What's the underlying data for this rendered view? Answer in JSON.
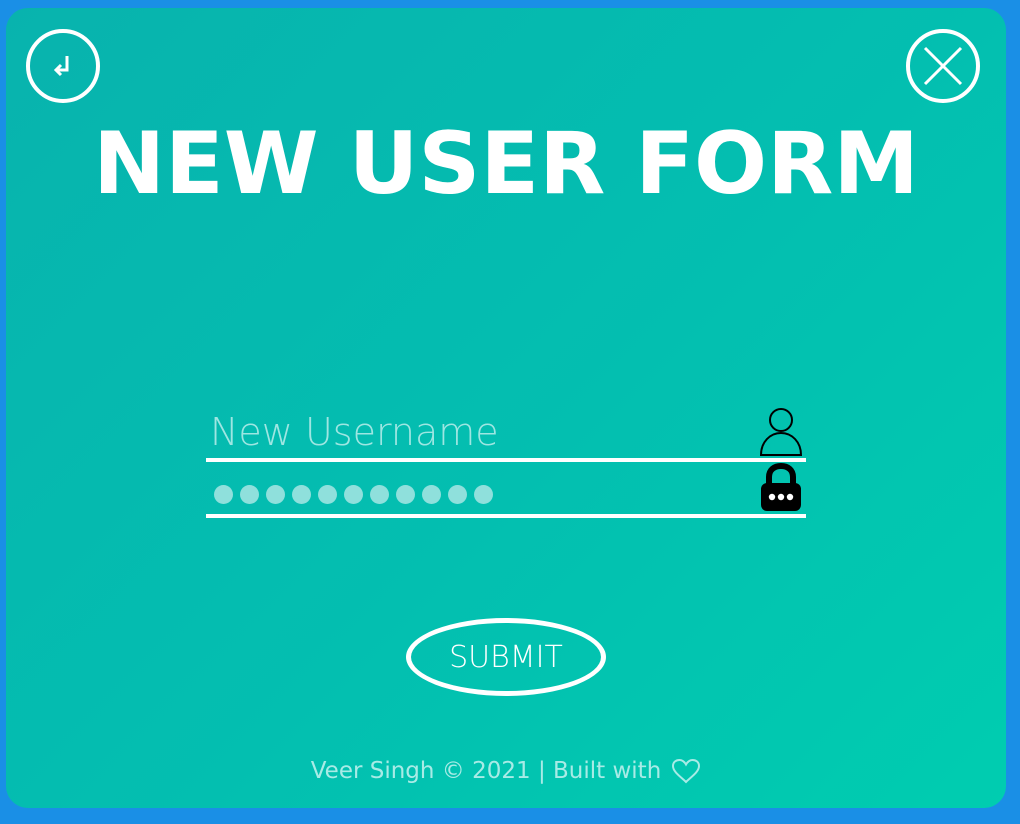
{
  "header": {
    "title": "NEW USER FORM",
    "back_icon": "return-arrow-icon",
    "close_icon": "close-x-icon"
  },
  "form": {
    "username": {
      "placeholder": "New Username",
      "value": "",
      "icon": "user-icon"
    },
    "password": {
      "masked_length": 11,
      "icon": "padlock-icon"
    },
    "submit_label": "SUBMIT"
  },
  "footer": {
    "text": "Veer Singh © 2021 | Built with",
    "icon": "heart-icon"
  },
  "colors": {
    "background": "#1a8fe6",
    "card_start": "#08b3ae",
    "card_end": "#00cdb0",
    "text": "#ffffff",
    "muted": "#a8ebe6"
  }
}
